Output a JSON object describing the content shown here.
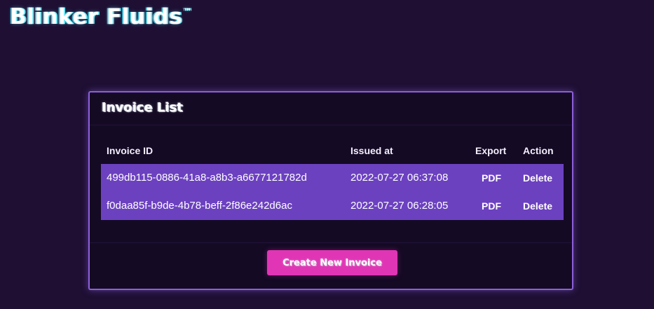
{
  "brand": {
    "name": "Blinker Fluids",
    "trademark": "™"
  },
  "invoice_list": {
    "title": "Invoice List",
    "columns": {
      "invoice_id": "Invoice ID",
      "issued_at": "Issued at",
      "export": "Export",
      "action": "Action"
    },
    "rows": [
      {
        "invoice_id": "499db115-0886-41a8-a8b3-a6677121782d",
        "issued_at": "2022-07-27 06:37:08",
        "export": "PDF",
        "action": "Delete"
      },
      {
        "invoice_id": "f0daa85f-b9de-4b78-beff-2f86e242d6ac",
        "issued_at": "2022-07-27 06:28:05",
        "export": "PDF",
        "action": "Delete"
      }
    ],
    "create_button_label": "Create New Invoice"
  },
  "colors": {
    "background": "#1e0f33",
    "card_background": "#140a24",
    "card_border": "#8d5fd8",
    "row_background": "#6c41c0",
    "button_background": "#e035b5",
    "brand_glow": "#6de7f5"
  }
}
